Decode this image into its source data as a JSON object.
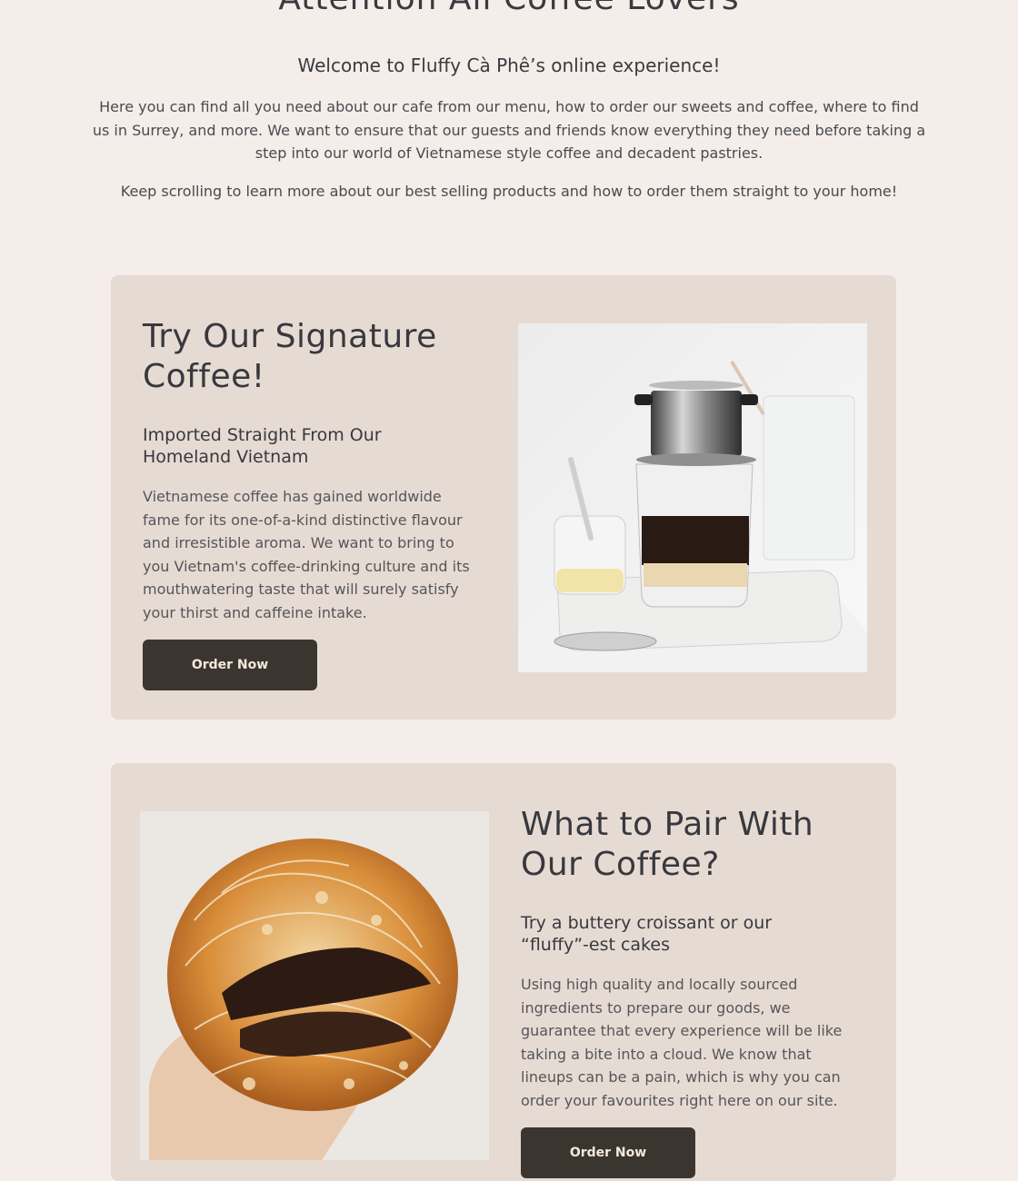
{
  "intro": {
    "title": "Attention All Coffee Lovers",
    "subtitle": "Welcome to Fluffy Cà Phê’s online experience!",
    "paragraph1": "Here you can find all you need about our cafe from our menu, how to order our sweets and coffee, where to find us in Surrey, and more. We want to ensure that our guests and friends know everything they need before taking a step into our world of Vietnamese style coffee and decadent pastries.",
    "paragraph2": "Keep scrolling to learn more about our best selling products and how to order them straight to your home!"
  },
  "features": [
    {
      "heading": "Try Our Signature Coffee!",
      "subheading": "Imported Straight From Our Homeland Vietnam",
      "body": "Vietnamese coffee has gained worldwide fame for its one-of-a-kind distinctive flavour and irresistible aroma. We want to bring to you Vietnam's coffee-drinking culture and its mouthwatering taste that will surely satisfy your thirst and caffeine intake.",
      "button_label": "Order Now"
    },
    {
      "heading": "What to Pair With Our Coffee?",
      "subheading": "Try a buttery croissant or our “fluffy”-est cakes",
      "body": "Using high quality and locally sourced ingredients to prepare our goods, we guarantee that every experience will be like taking a bite into a cloud. We know that lineups can be a pain, which is why you can order your favourites right here on our site.",
      "button_label": "Order Now"
    }
  ],
  "colors": {
    "page_bg": "#f4ede9",
    "card_bg": "#e6dbd3",
    "button_bg": "#3b3530",
    "button_text": "#f6e9db"
  }
}
